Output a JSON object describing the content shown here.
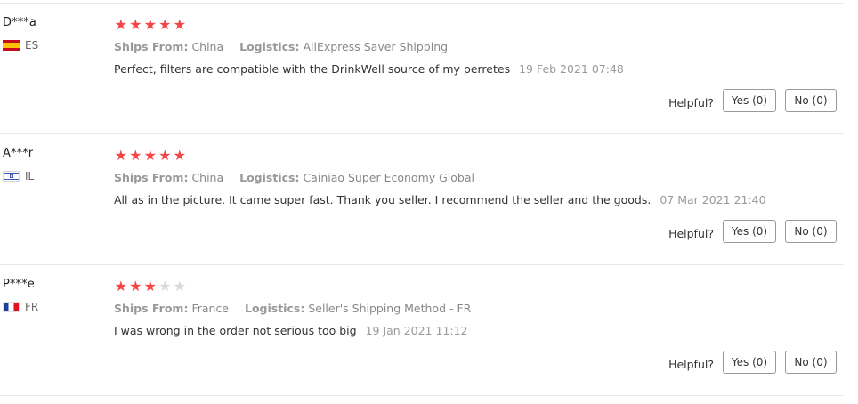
{
  "helpful_label": "Helpful?",
  "star_color": "#f44646",
  "reviews": [
    {
      "user": "D***a",
      "country": "ES",
      "flag_icon": "spain-flag-icon",
      "rating": 5,
      "ships_from_label": "Ships From:",
      "ships_from": "China",
      "logistics_label": "Logistics:",
      "logistics": "AliExpress Saver Shipping",
      "text": "Perfect, filters are compatible with the DrinkWell source of my perretes",
      "date": "19 Feb 2021 07:48",
      "yes": "Yes (0)",
      "no": "No (0)"
    },
    {
      "user": "A***r",
      "country": "IL",
      "flag_icon": "israel-flag-icon",
      "rating": 5,
      "ships_from_label": "Ships From:",
      "ships_from": "China",
      "logistics_label": "Logistics:",
      "logistics": "Cainiao Super Economy Global",
      "text": "All as in the picture. It came super fast. Thank you seller. I recommend the seller and the goods.",
      "date": "07 Mar 2021 21:40",
      "yes": "Yes (0)",
      "no": "No (0)"
    },
    {
      "user": "P***e",
      "country": "FR",
      "flag_icon": "france-flag-icon",
      "rating": 3,
      "ships_from_label": "Ships From:",
      "ships_from": "France",
      "logistics_label": "Logistics:",
      "logistics": "Seller's Shipping Method - FR",
      "text": "I was wrong in the order not serious too big",
      "date": "19 Jan 2021 11:12",
      "yes": "Yes (0)",
      "no": "No (0)"
    }
  ]
}
